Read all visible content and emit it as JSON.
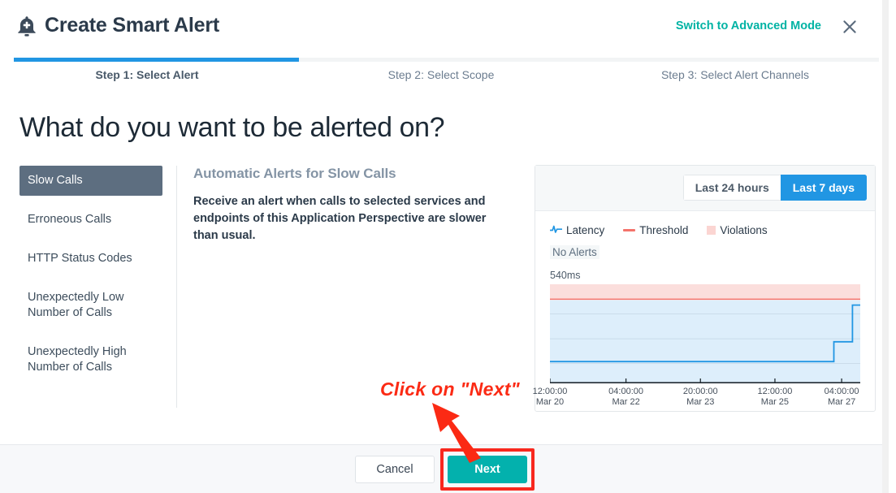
{
  "header": {
    "title": "Create Smart Alert",
    "bell_icon": "bell-plus-icon",
    "advanced_link": "Switch to Advanced Mode",
    "close_icon": "close-icon",
    "accent_teal": "#00b3a4"
  },
  "stepper": {
    "progress_percent": 33,
    "progress_color": "#2196e3",
    "steps": [
      {
        "label": "Step 1: Select Alert",
        "active": true
      },
      {
        "label": "Step 2: Select Scope",
        "active": false
      },
      {
        "label": "Step 3: Select Alert Channels",
        "active": false
      }
    ]
  },
  "main": {
    "question": "What do you want to be alerted on?",
    "alert_types": [
      {
        "label": "Slow Calls",
        "selected": true
      },
      {
        "label": "Erroneous Calls",
        "selected": false
      },
      {
        "label": "HTTP Status Codes",
        "selected": false
      },
      {
        "label": "Unexpectedly Low\nNumber of Calls",
        "selected": false
      },
      {
        "label": "Unexpectedly High\nNumber of Calls",
        "selected": false
      }
    ],
    "description": {
      "title": "Automatic Alerts for Slow Calls",
      "body": "Receive an alert when calls to selected services and endpoints of this Application Perspective are slower than usual."
    }
  },
  "chart_panel": {
    "ranges": [
      {
        "label": "Last 24 hours",
        "active": false
      },
      {
        "label": "Last 7 days",
        "active": true
      }
    ],
    "legend": [
      {
        "label": "Latency",
        "icon": "pulse-icon",
        "color": "#2196e3"
      },
      {
        "label": "Threshold",
        "icon": "line-swatch",
        "color": "#f4736b"
      },
      {
        "label": "Violations",
        "icon": "square-swatch",
        "color": "#fbd5d2"
      }
    ],
    "status": "No Alerts",
    "y_top_label": "540ms"
  },
  "chart_data": {
    "type": "line",
    "title": "",
    "xlabel": "",
    "ylabel": "ms",
    "ylim": [
      0,
      540
    ],
    "y_top_label": "540ms",
    "grid": true,
    "legend_position": "top-left",
    "x_ticks": [
      {
        "time": "12:00:00",
        "date": "Mar 20",
        "pos_pct": 0
      },
      {
        "time": "04:00:00",
        "date": "Mar 22",
        "pos_pct": 24.5
      },
      {
        "time": "20:00:00",
        "date": "Mar 23",
        "pos_pct": 48.5
      },
      {
        "time": "12:00:00",
        "date": "Mar 25",
        "pos_pct": 72.5
      },
      {
        "time": "04:00:00",
        "date": "Mar 27",
        "pos_pct": 94
      }
    ],
    "bands": [
      {
        "name": "Violations",
        "color": "#fbdedc",
        "from_pct": 86,
        "to_pct": 100
      },
      {
        "name": "Normal",
        "color": "#ddeefb",
        "from_pct": 0,
        "to_pct": 84
      }
    ],
    "threshold": {
      "name": "Threshold",
      "color": "#f4736b",
      "value_pct": 85
    },
    "series": [
      {
        "name": "Latency",
        "color": "#2196e3",
        "points": [
          {
            "x_pct": 0,
            "y_pct": 22
          },
          {
            "x_pct": 91.5,
            "y_pct": 22
          },
          {
            "x_pct": 91.5,
            "y_pct": 42
          },
          {
            "x_pct": 97.5,
            "y_pct": 42
          },
          {
            "x_pct": 97.5,
            "y_pct": 79
          },
          {
            "x_pct": 100,
            "y_pct": 79
          }
        ]
      }
    ]
  },
  "footer": {
    "cancel_label": "Cancel",
    "next_label": "Next",
    "next_color": "#03b1ad"
  },
  "annotation": {
    "text": "Click on \"Next\"",
    "color": "#fb2a14",
    "arrow_icon": "arrow-pointer-icon",
    "highlight_color": "#f8281e"
  }
}
